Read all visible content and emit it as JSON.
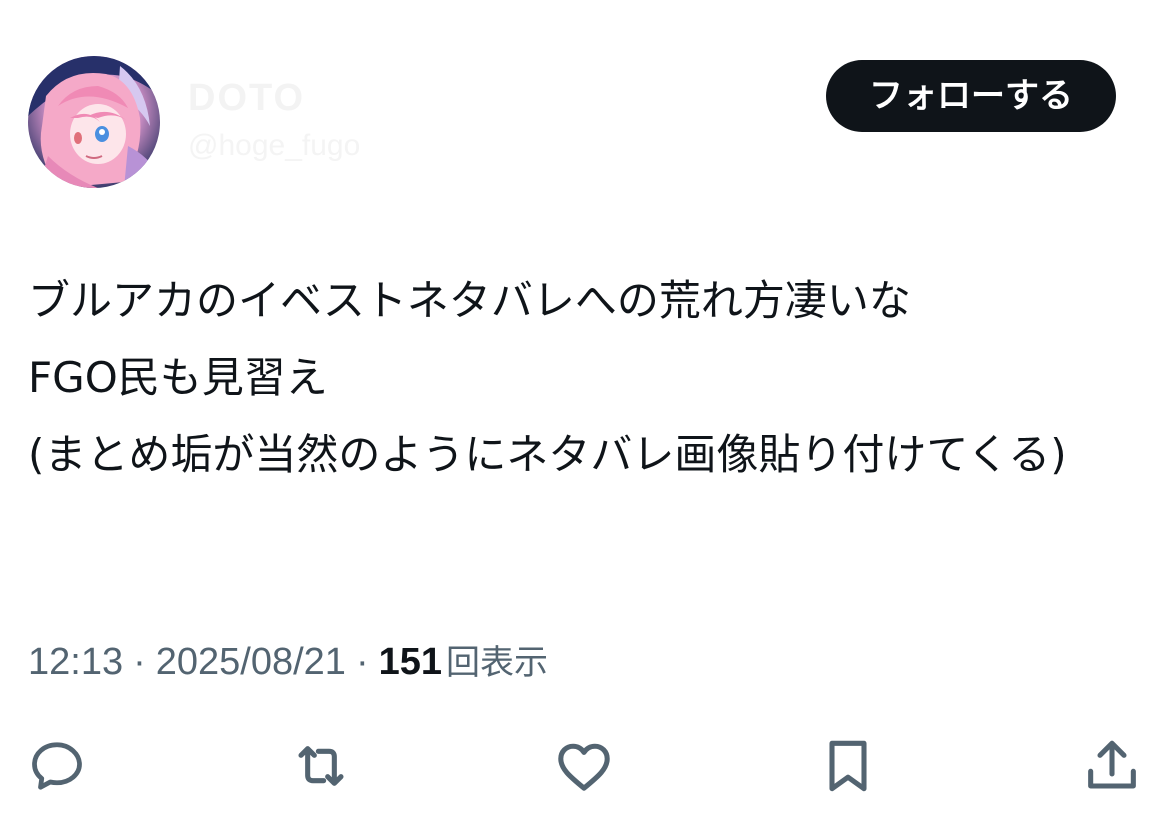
{
  "author": {
    "display_name": "DOTO",
    "handle": "@hoge_fugo"
  },
  "follow_button": {
    "label": "フォローする"
  },
  "tweet": {
    "text": "ブルアカのイベストネタバレへの荒れ方凄いな\nFGO民も見習え\n(まとめ垢が当然のようにネタバレ画像貼り付けてくる)"
  },
  "meta": {
    "time": "12:13",
    "separator": "·",
    "date": "2025/08/21",
    "views_count": "151",
    "views_label": "回表示"
  },
  "actions": [
    {
      "name": "reply",
      "icon": "reply-icon"
    },
    {
      "name": "retweet",
      "icon": "retweet-icon"
    },
    {
      "name": "like",
      "icon": "heart-icon"
    },
    {
      "name": "bookmark",
      "icon": "bookmark-icon"
    },
    {
      "name": "share",
      "icon": "share-icon"
    }
  ],
  "colors": {
    "text_primary": "#0f1419",
    "text_secondary": "#536471",
    "button_bg": "#0f1419",
    "button_text": "#ffffff"
  }
}
